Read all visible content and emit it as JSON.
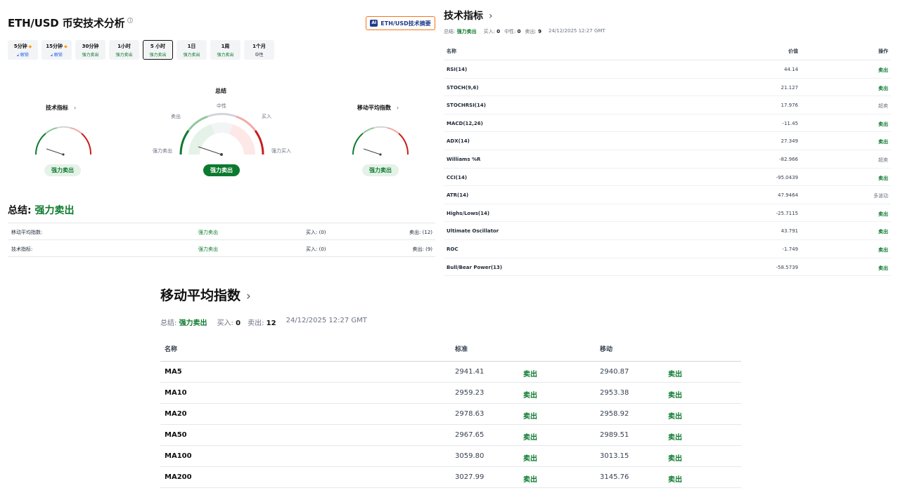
{
  "header": {
    "title": "ETH/USD 币安技术分析",
    "info_icon": "i",
    "ai_badge": "AI",
    "ai_button_label": "ETH/USD技术摘要"
  },
  "timeframes": [
    {
      "label": "5分钟",
      "signal": "解锁",
      "locked": true
    },
    {
      "label": "15分钟",
      "signal": "解锁",
      "locked": true
    },
    {
      "label": "30分钟",
      "signal": "强力卖出",
      "locked": false
    },
    {
      "label": "1小时",
      "signal": "强力卖出",
      "locked": false
    },
    {
      "label": "5 小时",
      "signal": "强力卖出",
      "locked": false,
      "active": true
    },
    {
      "label": "1日",
      "signal": "强力卖出",
      "locked": false
    },
    {
      "label": "1周",
      "signal": "强力卖出",
      "locked": false
    },
    {
      "label": "1个月",
      "signal": "中性",
      "locked": false
    }
  ],
  "gauges": {
    "overall_title": "总结",
    "tech_title": "技术指标",
    "ma_title": "移动平均指数",
    "labels": {
      "neutral": "中性",
      "sell": "卖出",
      "buy": "买入",
      "strong_sell": "强力卖出",
      "strong_buy": "强力买入"
    },
    "tech_result": "强力卖出",
    "overall_result": "强力卖出",
    "ma_result": "强力卖出"
  },
  "summary": {
    "title_prefix": "总结:",
    "title_value": "强力卖出",
    "rows": [
      {
        "name": "移动平均指数:",
        "signal": "强力卖出",
        "buy": "买入: (0)",
        "sell": "卖出: (12)"
      },
      {
        "name": "技术指标:",
        "signal": "强力卖出",
        "buy": "买入: (0)",
        "sell": "卖出: (9)"
      }
    ]
  },
  "indicators": {
    "title": "技术指标",
    "meta": {
      "summary_label": "总结:",
      "summary_value": "强力卖出",
      "buy_label": "买入:",
      "buy_value": "0",
      "neutral_label": "中性:",
      "neutral_value": "0",
      "sell_label": "卖出:",
      "sell_value": "9",
      "timestamp": "24/12/2025 12:27 GMT"
    },
    "columns": {
      "name": "名称",
      "value": "价值",
      "action": "操作"
    },
    "rows": [
      {
        "name": "RSI(14)",
        "value": "44.14",
        "action": "卖出",
        "kind": "sell"
      },
      {
        "name": "STOCH(9,6)",
        "value": "21.127",
        "action": "卖出",
        "kind": "sell"
      },
      {
        "name": "STOCHRSI(14)",
        "value": "17.976",
        "action": "超卖",
        "kind": "neutral"
      },
      {
        "name": "MACD(12,26)",
        "value": "-11.45",
        "action": "卖出",
        "kind": "sell"
      },
      {
        "name": "ADX(14)",
        "value": "27.349",
        "action": "卖出",
        "kind": "sell"
      },
      {
        "name": "Williams %R",
        "value": "-82.966",
        "action": "超卖",
        "kind": "neutral"
      },
      {
        "name": "CCI(14)",
        "value": "-95.0439",
        "action": "卖出",
        "kind": "sell"
      },
      {
        "name": "ATR(14)",
        "value": "47.9464",
        "action": "多波动",
        "kind": "neutral"
      },
      {
        "name": "Highs/Lows(14)",
        "value": "-25.7115",
        "action": "卖出",
        "kind": "sell"
      },
      {
        "name": "Ultimate Oscillator",
        "value": "43.791",
        "action": "卖出",
        "kind": "sell"
      },
      {
        "name": "ROC",
        "value": "-1.749",
        "action": "卖出",
        "kind": "sell"
      },
      {
        "name": "Bull/Bear Power(13)",
        "value": "-58.5739",
        "action": "卖出",
        "kind": "sell"
      }
    ]
  },
  "moving_averages": {
    "title": "移动平均指数",
    "meta": {
      "summary_label": "总结:",
      "summary_value": "强力卖出",
      "buy_label": "买入:",
      "buy_value": "0",
      "sell_label": "卖出:",
      "sell_value": "12",
      "timestamp": "24/12/2025 12:27 GMT"
    },
    "columns": {
      "name": "名称",
      "simple": "标准",
      "exponential": "移动"
    },
    "rows": [
      {
        "name": "MA5",
        "simple": "2941.41",
        "simple_action": "卖出",
        "exp": "2940.87",
        "exp_action": "卖出"
      },
      {
        "name": "MA10",
        "simple": "2959.23",
        "simple_action": "卖出",
        "exp": "2953.38",
        "exp_action": "卖出"
      },
      {
        "name": "MA20",
        "simple": "2978.63",
        "simple_action": "卖出",
        "exp": "2958.92",
        "exp_action": "卖出"
      },
      {
        "name": "MA50",
        "simple": "2967.65",
        "simple_action": "卖出",
        "exp": "2989.51",
        "exp_action": "卖出"
      },
      {
        "name": "MA100",
        "simple": "3059.80",
        "simple_action": "卖出",
        "exp": "3013.15",
        "exp_action": "卖出"
      },
      {
        "name": "MA200",
        "simple": "3027.99",
        "simple_action": "卖出",
        "exp": "3145.76",
        "exp_action": "卖出"
      }
    ]
  },
  "colors": {
    "sell": "#0c7a2e",
    "buy_zone": "#dc2626",
    "accent_orange": "#f97316"
  }
}
